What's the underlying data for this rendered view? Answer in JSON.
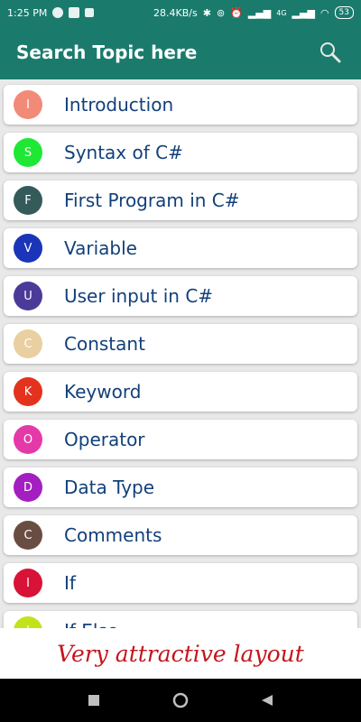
{
  "status_bar": {
    "time": "1:25 PM",
    "network_speed": "28.4KB/s",
    "network_type": "4G",
    "battery": "53"
  },
  "app_bar": {
    "title": "Search Topic here"
  },
  "topics": [
    {
      "letter": "I",
      "label": "Introduction",
      "color": "#f28a78"
    },
    {
      "letter": "S",
      "label": "Syntax of C#",
      "color": "#1ee834"
    },
    {
      "letter": "F",
      "label": "First Program in C#",
      "color": "#345a5a"
    },
    {
      "letter": "V",
      "label": "Variable",
      "color": "#1a35b8"
    },
    {
      "letter": "U",
      "label": "User input in C#",
      "color": "#4b3a98"
    },
    {
      "letter": "C",
      "label": "Constant",
      "color": "#e9cfa1"
    },
    {
      "letter": "K",
      "label": "Keyword",
      "color": "#e3321e"
    },
    {
      "letter": "O",
      "label": "Operator",
      "color": "#e43aa9"
    },
    {
      "letter": "D",
      "label": "Data Type",
      "color": "#a41fc0"
    },
    {
      "letter": "C",
      "label": "Comments",
      "color": "#6a4d42"
    },
    {
      "letter": "I",
      "label": "If",
      "color": "#d81337"
    },
    {
      "letter": "I",
      "label": "If Else",
      "color": "#c3e21a"
    }
  ],
  "banner": {
    "text": "Very attractive layout"
  },
  "nav_bar": {
    "buttons": [
      "recent-apps",
      "home",
      "back"
    ]
  }
}
